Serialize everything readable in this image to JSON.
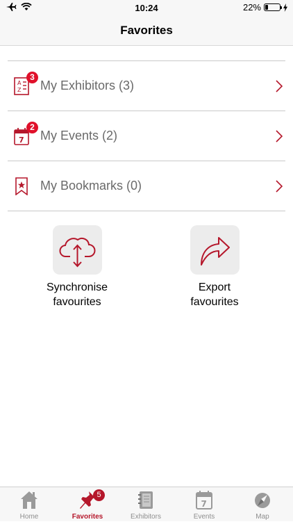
{
  "status_bar": {
    "time": "10:24",
    "battery_text": "22%",
    "battery_level": 0.22,
    "icons": [
      "airplane-icon",
      "wifi-icon",
      "battery-icon",
      "charging-icon"
    ]
  },
  "nav": {
    "title": "Favorites"
  },
  "list": {
    "items": [
      {
        "label": "My Exhibitors (3)",
        "badge": "3",
        "icon": "az-list-icon"
      },
      {
        "label": "My Events (2)",
        "badge": "2",
        "icon": "calendar-icon"
      },
      {
        "label": "My Bookmarks (0)",
        "badge": "",
        "icon": "bookmark-star-icon"
      }
    ]
  },
  "actions": {
    "sync": {
      "line1": "Synchronise",
      "line2": "favourites",
      "icon": "cloud-sync-icon"
    },
    "export": {
      "line1": "Export",
      "line2": "favourites",
      "icon": "share-arrow-icon"
    }
  },
  "tabs": [
    {
      "label": "Home",
      "icon": "house-icon",
      "active": false
    },
    {
      "label": "Favorites",
      "icon": "pin-icon",
      "active": true,
      "badge": "5"
    },
    {
      "label": "Exhibitors",
      "icon": "notebook-icon",
      "active": false
    },
    {
      "label": "Events",
      "icon": "calendar-icon",
      "active": false
    },
    {
      "label": "Map",
      "icon": "compass-icon",
      "active": false
    }
  ],
  "colors": {
    "accent": "#b5172b",
    "badge": "#e0102a",
    "tile_bg": "#ececec",
    "bar_bg": "#f7f7f7",
    "inactive_tab": "#8e8e8e"
  }
}
